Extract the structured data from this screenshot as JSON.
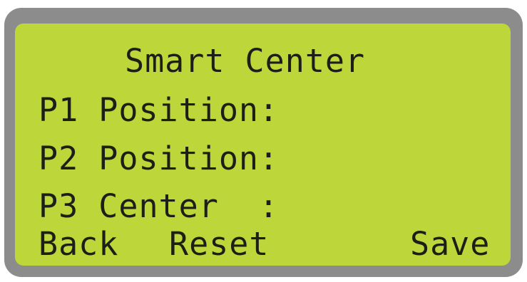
{
  "screen": {
    "title": "Smart Center",
    "rows": [
      {
        "label": "P1 Position:"
      },
      {
        "label": "P2 Position:"
      },
      {
        "label": "P3 Center  :"
      }
    ],
    "softkeys": {
      "back": "Back",
      "reset": "Reset",
      "save": "Save"
    }
  },
  "colors": {
    "lcd_background": "#bdd63a",
    "lcd_text": "#1c1f17",
    "bezel": "#8c8c8c"
  }
}
